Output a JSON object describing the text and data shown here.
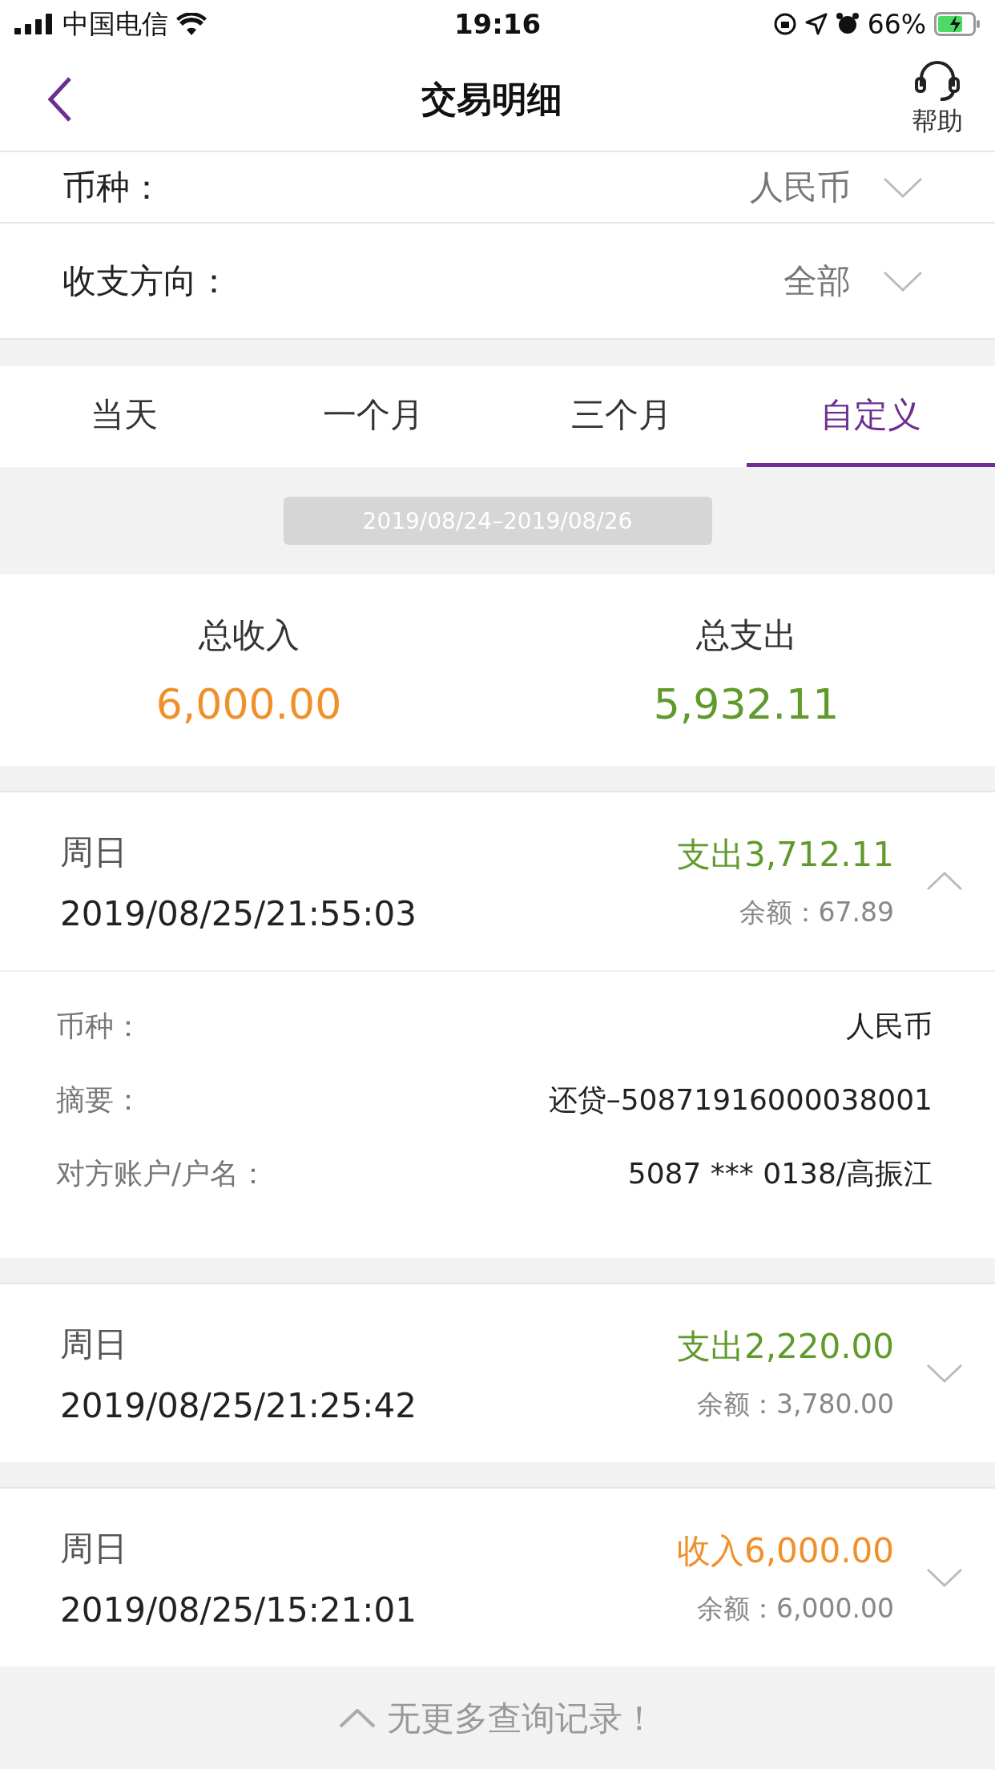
{
  "status_bar": {
    "carrier": "中国电信",
    "time": "19:16",
    "battery": "66%"
  },
  "nav": {
    "title": "交易明细",
    "help": "帮助"
  },
  "filters": [
    {
      "label": "币种：",
      "value": "人民币"
    },
    {
      "label": "收支方向：",
      "value": "全部"
    }
  ],
  "tabs": [
    {
      "label": "当天",
      "selected": false
    },
    {
      "label": "一个月",
      "selected": false
    },
    {
      "label": "三个月",
      "selected": false
    },
    {
      "label": "自定义",
      "selected": true
    }
  ],
  "date_range": "2019/08/24–2019/08/26",
  "totals": [
    {
      "label": "总收入",
      "value": "6,000.00",
      "kind": "income"
    },
    {
      "label": "总支出",
      "value": "5,932.11",
      "kind": "expense"
    }
  ],
  "records": [
    {
      "weekday": "周日",
      "datetime": "2019/08/25/21:55:03",
      "amount": "支出3,712.11",
      "kind": "expense",
      "balance": "余额：67.89",
      "expanded": true,
      "details": [
        {
          "label": "币种：",
          "value": "人民币"
        },
        {
          "label": "摘要：",
          "value": "还贷–50871916000038001"
        },
        {
          "label": "对方账户/户名：",
          "value": "5087 *** 0138/高振江"
        }
      ]
    },
    {
      "weekday": "周日",
      "datetime": "2019/08/25/21:25:42",
      "amount": "支出2,220.00",
      "kind": "expense",
      "balance": "余额：3,780.00",
      "expanded": false
    },
    {
      "weekday": "周日",
      "datetime": "2019/08/25/15:21:01",
      "amount": "收入6,000.00",
      "kind": "income",
      "balance": "余额：6,000.00",
      "expanded": false
    }
  ],
  "footer": "无更多查询记录！"
}
